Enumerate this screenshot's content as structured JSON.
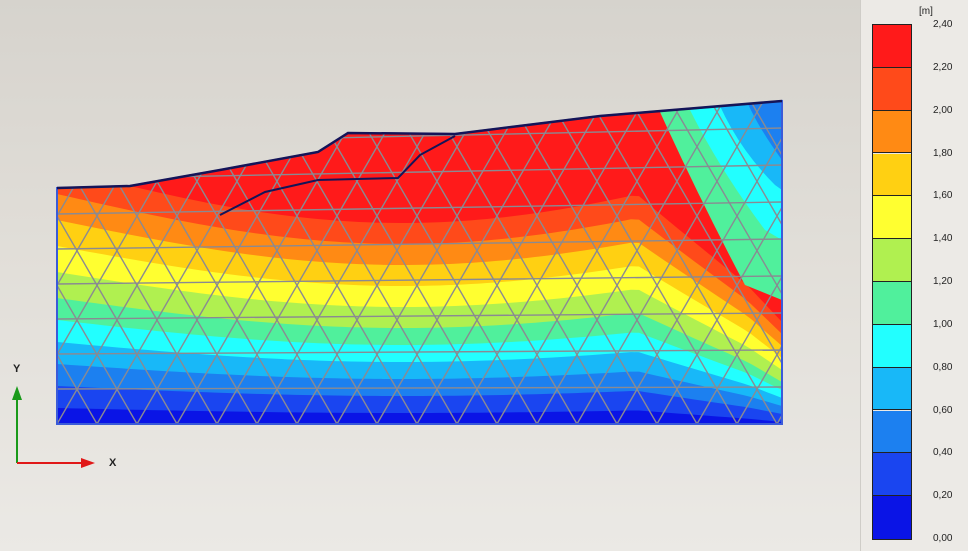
{
  "axes": {
    "y_label": "Y",
    "x_label": "X"
  },
  "legend": {
    "unit": "[m]",
    "ticks": [
      "2,40",
      "2,20",
      "2,00",
      "1,80",
      "1,60",
      "1,40",
      "1,20",
      "1,00",
      "0,80",
      "0,60",
      "0,40",
      "0,20",
      "0,00"
    ],
    "colors_top_to_bottom": [
      "#ff1a1a",
      "#ff4a1a",
      "#ff8a14",
      "#ffd012",
      "#ffff30",
      "#b0f050",
      "#50f09c",
      "#22ffff",
      "#18b8f8",
      "#1c80f0",
      "#1a45f0",
      "#0a14e6"
    ]
  },
  "colors": {
    "mesh": "#8a8a92",
    "outline": "#3b5bd9",
    "surface_line": "#141458"
  }
}
